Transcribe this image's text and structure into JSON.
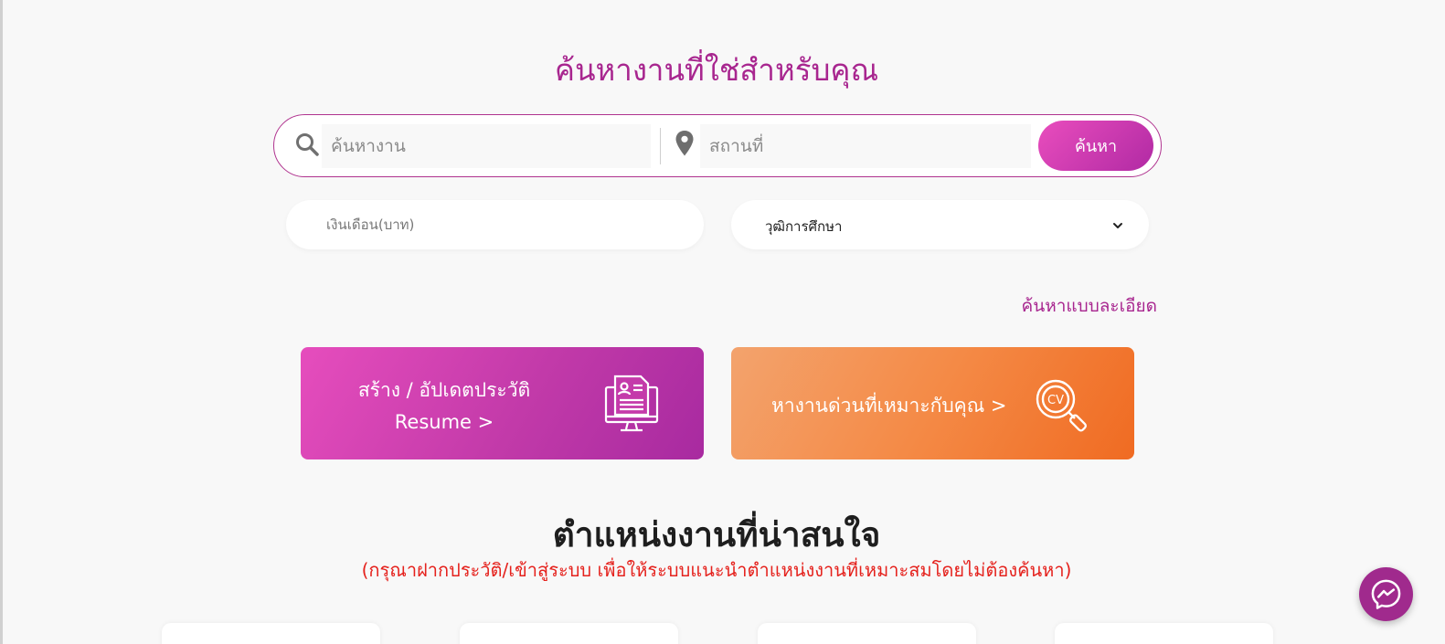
{
  "header": {
    "title": "ค้นหางานที่ใช่สำหรับคุณ"
  },
  "search": {
    "keyword_placeholder": "ค้นหางาน",
    "location_placeholder": "สถานที่",
    "button_label": "ค้นหา"
  },
  "filters": {
    "salary_placeholder": "เงินเดือน(บาท)",
    "education_label": "วุฒิการศึกษา"
  },
  "advanced_search_label": "ค้นหาแบบละเอียด",
  "banners": {
    "resume": {
      "line1": "สร้าง / อัปเดตประวัติ",
      "line2": "Resume >",
      "icon": "resume-computer-icon"
    },
    "urgent": {
      "label": "หางานด่วนที่เหมาะกับคุณ >",
      "icon": "cv-search-icon"
    }
  },
  "recommended": {
    "title": "ตำแหน่งงานที่น่าสนใจ",
    "note": "(กรุณาฝากประวัติ/เข้าสู่ระบบ เพื่อให้ระบบแนะนำตำแหน่งงานที่เหมาะสมโดยไม่ต้องค้นหา)"
  },
  "colors": {
    "brand_purple": "#a8268f",
    "button_gradient_start": "#e94dbd",
    "button_gradient_end": "#b12aa4",
    "orange": "#f48a46",
    "note_red": "#e5221d"
  },
  "messenger": {
    "icon": "messenger-icon"
  }
}
